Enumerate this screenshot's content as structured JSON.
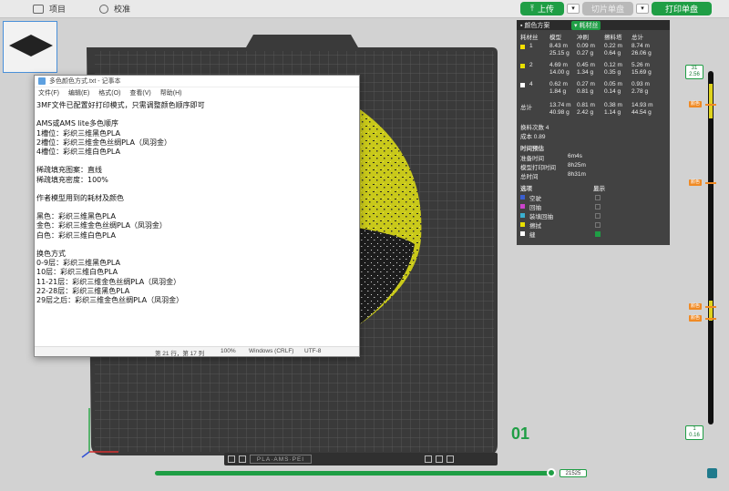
{
  "toolbar": {
    "project_label": "项目",
    "calibrate_label": "校准",
    "upload_label": "上传",
    "slice_label": "切片单盘",
    "print_label": "打印单盘"
  },
  "notepad": {
    "title": "多色颜色方式.txt - 记事本",
    "menu": [
      "文件(F)",
      "编辑(E)",
      "格式(O)",
      "查看(V)",
      "帮助(H)"
    ],
    "lines": [
      "3MF文件已配置好打印模式，只需调整颜色顺序即可",
      "",
      "AMS或AMS lite多色顺序",
      "1槽位：彩织三维黑色PLA",
      "2槽位：彩织三维金色丝绸PLA（凤羽金）",
      "4槽位：彩织三维白色PLA",
      "",
      "稀疏填充图案：直线",
      "稀疏填充密度：100%",
      "",
      "作者模型用到的耗材及颜色",
      "",
      "黑色：彩织三维黑色PLA",
      "金色：彩织三维金色丝绸PLA（凤羽金）",
      "白色：彩织三维白色PLA",
      "",
      "换色方式",
      "0-9层：彩织三维黑色PLA",
      "10层：彩织三维白色PLA",
      "11-21层：彩织三维金色丝绸PLA（凤羽金）",
      "22-28层：彩织三维黑色PLA",
      "29层之后：彩织三维金色丝绸PLA（凤羽金）"
    ],
    "status": {
      "position": "第 21 行，第 17 列",
      "zoom": "100%",
      "eol": "Windows (CRLF)",
      "encoding": "UTF-8"
    }
  },
  "panel": {
    "tab_color_scheme": "颜色方案",
    "tab_filament": "耗材丝",
    "headers": [
      "耗材丝",
      "模型",
      "冲刷",
      "擦料塔",
      "总计"
    ],
    "filaments": [
      {
        "id": "1",
        "color": "#f5e000",
        "model_m": "8.43 m",
        "model_g": "25.15 g",
        "flush_m": "0.09 m",
        "flush_g": "0.27 g",
        "tower_m": "0.22 m",
        "tower_g": "0.64 g",
        "total_m": "8.74 m",
        "total_g": "26.06 g"
      },
      {
        "id": "2",
        "color": "#e8e000",
        "model_m": "4.69 m",
        "model_g": "14.00 g",
        "flush_m": "0.45 m",
        "flush_g": "1.34 g",
        "tower_m": "0.12 m",
        "tower_g": "0.35 g",
        "total_m": "5.26 m",
        "total_g": "15.69 g"
      },
      {
        "id": "4",
        "color": "#ffffff",
        "model_m": "0.62 m",
        "model_g": "1.84 g",
        "flush_m": "0.27 m",
        "flush_g": "0.81 g",
        "tower_m": "0.05 m",
        "tower_g": "0.14 g",
        "total_m": "0.93 m",
        "total_g": "2.78 g"
      }
    ],
    "total": {
      "label": "总计",
      "model_m": "13.74 m",
      "model_g": "40.98 g",
      "flush_m": "0.81 m",
      "flush_g": "2.42 g",
      "tower_m": "0.38 m",
      "tower_g": "1.14 g",
      "total_m": "14.93 m",
      "total_g": "44.54 g"
    },
    "changes": "换料次数  4",
    "cost": "成本  0.89",
    "time_title": "时间预估",
    "time_rows": [
      {
        "label": "准备时间",
        "value": "6m4s"
      },
      {
        "label": "模型打印时间",
        "value": "8h25m"
      },
      {
        "label": "总时间",
        "value": "8h31m"
      }
    ],
    "opt_header": "选项",
    "show_header": "显示",
    "options": [
      {
        "label": "空驶",
        "color": "#3a5fd0",
        "on": false
      },
      {
        "label": "回抽",
        "color": "#cc44cc",
        "on": false
      },
      {
        "label": "装填回抽",
        "color": "#3ab0d0",
        "on": false
      },
      {
        "label": "擦拭",
        "color": "#e8e000",
        "on": false
      },
      {
        "label": "缝",
        "color": "#ffffff",
        "on": true
      }
    ]
  },
  "slider": {
    "top_layer": "31",
    "top_height": "2.56",
    "bottom_layer": "1",
    "bottom_height": "0.16",
    "tag_label": "颜色"
  },
  "bottom": {
    "move_value": "21525",
    "plate_number": "01",
    "plate_name": "PLA·AMS·PEI"
  }
}
